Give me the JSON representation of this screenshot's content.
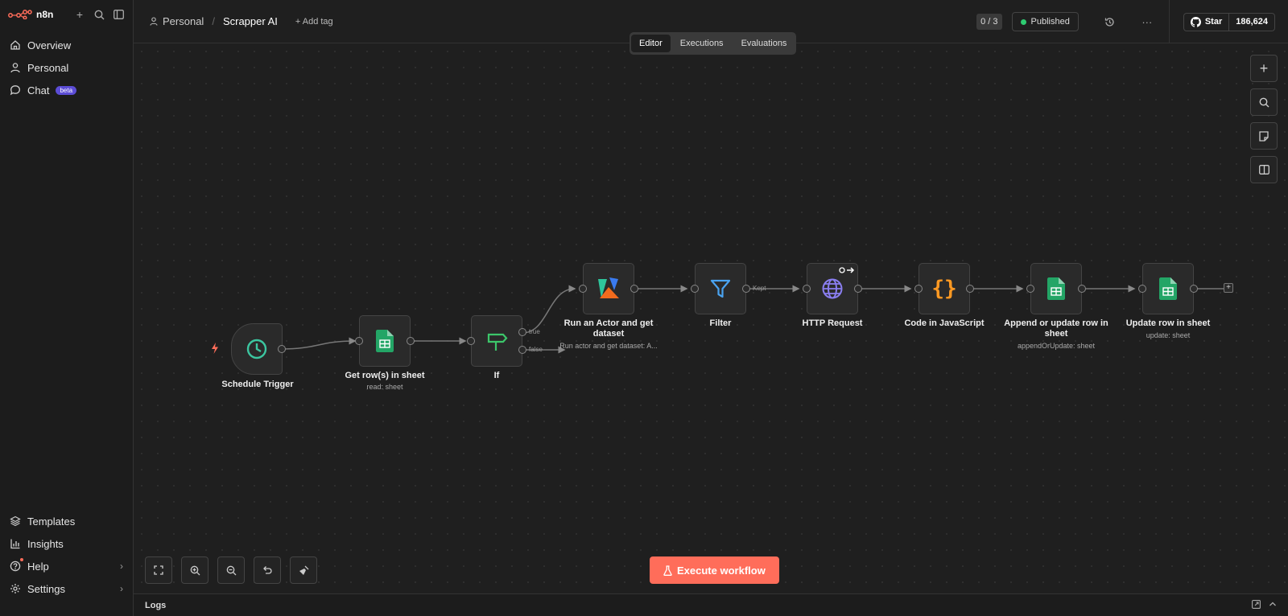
{
  "app": {
    "name": "n8n"
  },
  "sidebar": {
    "items": [
      {
        "label": "Overview"
      },
      {
        "label": "Personal"
      },
      {
        "label": "Chat",
        "badge": "beta"
      }
    ],
    "bottom": [
      {
        "label": "Templates"
      },
      {
        "label": "Insights"
      },
      {
        "label": "Help"
      },
      {
        "label": "Settings"
      }
    ]
  },
  "header": {
    "project": "Personal",
    "workflow_name": "Scrapper AI",
    "add_tag": "+ Add tag",
    "counter": "0 / 3",
    "status": "Published",
    "github_star": "Star",
    "github_count": "186,624"
  },
  "tabs": [
    {
      "label": "Editor"
    },
    {
      "label": "Executions"
    },
    {
      "label": "Evaluations"
    }
  ],
  "nodes": [
    {
      "label": "Schedule Trigger",
      "sub": ""
    },
    {
      "label": "Get row(s) in sheet",
      "sub": "read: sheet"
    },
    {
      "label": "If",
      "sub": ""
    },
    {
      "label": "Run an Actor and get dataset",
      "sub": "Run actor and get dataset: A..."
    },
    {
      "label": "Filter",
      "sub": ""
    },
    {
      "label": "HTTP Request",
      "sub": ""
    },
    {
      "label": "Code in JavaScript",
      "sub": ""
    },
    {
      "label": "Append or update row in sheet",
      "sub": "appendOrUpdate: sheet"
    },
    {
      "label": "Update row in sheet",
      "sub": "update: sheet"
    }
  ],
  "edge_labels": {
    "true": "true",
    "false": "false",
    "kept": "Kept"
  },
  "execute_button": "Execute workflow",
  "logs": {
    "label": "Logs"
  },
  "colors": {
    "accent": "#ff6d5a",
    "published": "#2ecc71",
    "sheets": "#23a566",
    "code": "#ff9922",
    "http": "#8a7ef0",
    "filter": "#4aa3f0"
  }
}
